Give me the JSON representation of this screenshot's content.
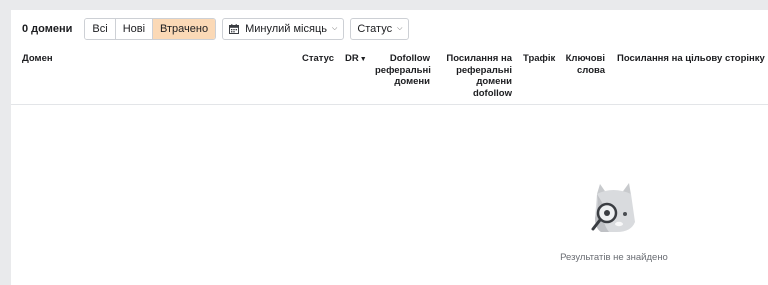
{
  "toolbar": {
    "count_label": "0 домени",
    "filters": [
      {
        "label": "Всі",
        "active": false
      },
      {
        "label": "Нові",
        "active": false
      },
      {
        "label": "Втрачено",
        "active": true
      }
    ],
    "date_range": {
      "label": "Минулий місяць",
      "icon": "calendar-icon"
    },
    "status_filter": {
      "label": "Статус"
    }
  },
  "table": {
    "columns": {
      "domain": "Домен",
      "status": "Статус",
      "dr": "DR",
      "dofollow_ref_domains": "Dofollow реферальні домени",
      "links_to_ref_dofollow": "Посилання на реферальні домени dofollow",
      "traffic": "Трафік",
      "keywords": "Ключові слова",
      "target_link": "Посилання на цільову сторінку"
    },
    "sort": {
      "column": "DR",
      "direction": "desc"
    }
  },
  "empty_state": {
    "message": "Результатів не знайдено",
    "illustration": "mascot-with-magnifier"
  },
  "colors": {
    "active_filter_bg": "#fbd9b6",
    "page_bg": "#e9eaec",
    "panel_bg": "#ffffff"
  }
}
